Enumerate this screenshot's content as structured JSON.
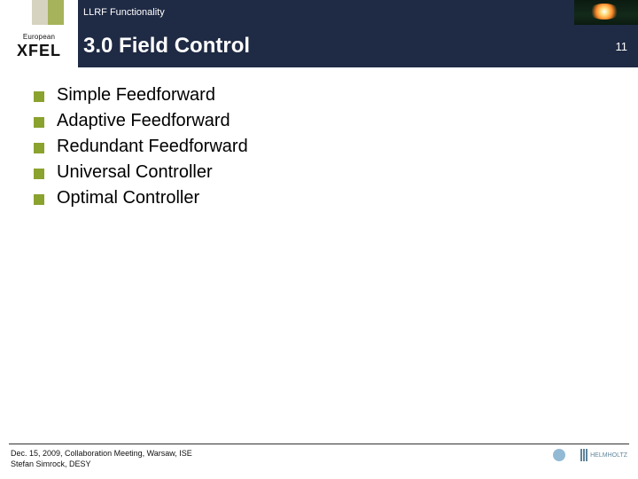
{
  "header": {
    "breadcrumb": "LLRF Functionality",
    "title": "3.0 Field Control",
    "page_number": "11",
    "logo": {
      "top": "European",
      "main": "XFEL"
    }
  },
  "bullets": [
    "Simple Feedforward",
    "Adaptive Feedforward",
    "Redundant Feedforward",
    "Universal Controller",
    "Optimal Controller"
  ],
  "footer": {
    "line1": "Dec. 15, 2009, Collaboration Meeting, Warsaw, ISE",
    "line2": "Stefan Simrock, DESY"
  }
}
